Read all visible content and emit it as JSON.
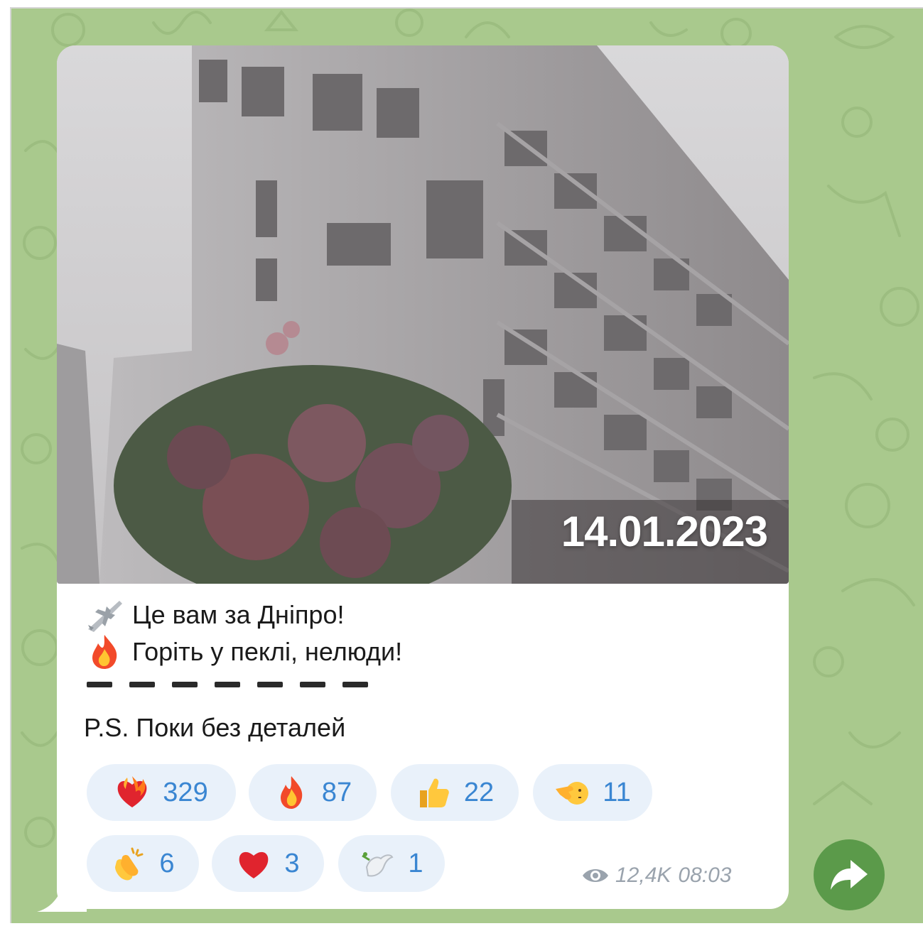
{
  "post": {
    "photo_date": "14.01.2023",
    "caption_line_1": "Це вам за Дніпро!",
    "caption_line_2": "Горіть у пеклі, нелюди!",
    "ps_text": "P.S. Поки без деталей",
    "caption_icons": [
      "airplane-icon",
      "fire-icon"
    ]
  },
  "reactions": [
    {
      "icon": "heart-on-fire-icon",
      "count": "329"
    },
    {
      "icon": "fire-icon",
      "count": "87"
    },
    {
      "icon": "thumbs-up-icon",
      "count": "22"
    },
    {
      "icon": "pointing-left-face-icon",
      "count": "11"
    },
    {
      "icon": "clapping-hands-icon",
      "count": "6"
    },
    {
      "icon": "red-heart-icon",
      "count": "3"
    },
    {
      "icon": "dove-icon",
      "count": "1"
    }
  ],
  "meta": {
    "views": "12,4K",
    "time": "08:03"
  },
  "colors": {
    "chat_background": "#a9c98d",
    "bubble": "#ffffff",
    "reaction_pill": "#e9f1fa",
    "reaction_count": "#3a86d2",
    "forward_button": "#5b9a4a",
    "meta_text": "#9aa3ad"
  }
}
